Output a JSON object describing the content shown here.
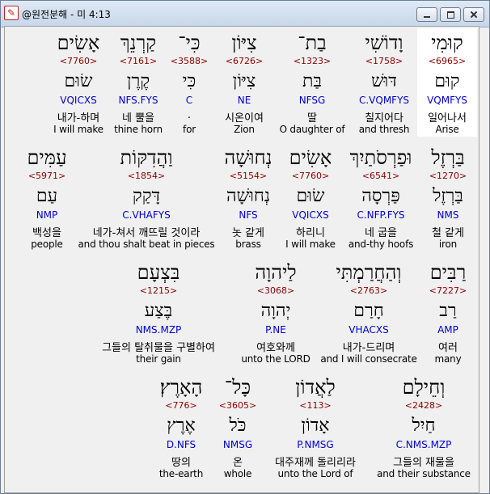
{
  "window": {
    "title": "@원전분해 - 미 4:13",
    "min_label": "minimize",
    "max_label": "maximize",
    "close_label": "close"
  },
  "colors": {
    "strongs": "#8b0000",
    "parse": "#0000cc",
    "highlight": "#ffffff"
  },
  "rows": [
    [
      {
        "heb": "קוּמִי",
        "num": "<6965>",
        "lemma": "קוּם",
        "parse": "VQMFYS",
        "kor": "일어나서",
        "eng": "Arise"
      },
      {
        "heb": "וָדוֹשִׁי",
        "num": "<1758>",
        "lemma": "דּוּשׁ",
        "parse": "C.VQMFYS",
        "kor": "칠지어다",
        "eng": "and thresh"
      },
      {
        "heb": "בַת־",
        "num": "<1323>",
        "lemma": "בַּת",
        "parse": "NFSG",
        "kor": "딸",
        "eng": "O daughter of"
      },
      {
        "heb": "צִיּוֹן",
        "num": "<6726>",
        "lemma": "צִיּוֹן",
        "parse": "NE",
        "kor": "시온이여",
        "eng": "Zion"
      },
      {
        "heb": "כִּי־",
        "num": "<3588>",
        "lemma": "כִּי",
        "parse": "C",
        "kor": ".",
        "eng": "for"
      },
      {
        "heb": "קַרְנֵךְ",
        "num": "<7161>",
        "lemma": "קֶרֶן",
        "parse": "NFS.FYS",
        "kor": "네 뿔을",
        "eng": "thine horn"
      },
      {
        "heb": "אָשִׂים",
        "num": "<7760>",
        "lemma": "שׂוּם",
        "parse": "VQICXS",
        "kor": "내가-하며",
        "eng": "I will make"
      }
    ],
    [
      {
        "heb": "בַּרְזֶל",
        "num": "<1270>",
        "lemma": "בַּרְזֶל",
        "parse": "NMS",
        "kor": "철 같게",
        "eng": "iron"
      },
      {
        "heb": "וּפַרְסֹתַיִךְ",
        "num": "<6541>",
        "lemma": "פַּרְסָה",
        "parse": "C.NFP.FYS",
        "kor": "네 굽을",
        "eng": "and-thy hoofs"
      },
      {
        "heb": "אָשִׂים",
        "num": "<7760>",
        "lemma": "שׂוּם",
        "parse": "VQICXS",
        "kor": "하리니",
        "eng": "I will make"
      },
      {
        "heb": "נְחוּשָׁה",
        "num": "<5154>",
        "lemma": "נְחוּשָׁה",
        "parse": "NFS",
        "kor": "놋 같게",
        "eng": "brass"
      },
      {
        "heb": "וַהֲדִקּוֹת",
        "num": "<1854>",
        "lemma": "דָּקַק",
        "parse": "C.VHAFYS",
        "kor": "네가-쳐서 깨뜨릴 것이라",
        "eng": "and thou shalt beat in pieces"
      },
      {
        "heb": "עַמִּים",
        "num": "<5971>",
        "lemma": "עַם",
        "parse": "NMP",
        "kor": "백성을",
        "eng": "people"
      }
    ],
    [
      {
        "heb": "רַבִּים",
        "num": "<7227>",
        "lemma": "רַב",
        "parse": "AMP",
        "kor": "여러",
        "eng": "many"
      },
      {
        "heb": "וְהַחֲרַמְתִּי",
        "num": "<2763>",
        "lemma": "חָרַם",
        "parse": "VHACXS",
        "kor": "내가-드리며",
        "eng": "and I will consecrate"
      },
      {
        "heb": "לַיהוָה",
        "num": "<3068>",
        "lemma": "יְהוָה",
        "parse": "P.NE",
        "kor": "여호와께",
        "eng": "unto the LORD"
      },
      {
        "heb": "בִּצְעָם",
        "num": "<1215>",
        "lemma": "בֶּצַע",
        "parse": "NMS.MZP",
        "kor": "그들의 탈취물을 구별하여",
        "eng": "their gain"
      }
    ],
    [
      {
        "heb": "וְחֵילָם",
        "num": "<2428>",
        "lemma": "חַיִל",
        "parse": "C.NMS.MZP",
        "kor": "그들의 재물을",
        "eng": "and their substance"
      },
      {
        "heb": "לַאֲדוֹן",
        "num": "<113>",
        "lemma": "אָדוֹן",
        "parse": "P.NMSG",
        "kor": "대주재께 돌리리라",
        "eng": "unto the Lord of"
      },
      {
        "heb": "כָּל־",
        "num": "<3605>",
        "lemma": "כֹּל",
        "parse": "NMSG",
        "kor": "온",
        "eng": "whole"
      },
      {
        "heb": "הָאָרֶץ׃",
        "num": "<776>",
        "lemma": "אֶרֶץ",
        "parse": "D.NFS",
        "kor": "땅의",
        "eng": "the-earth"
      }
    ]
  ]
}
